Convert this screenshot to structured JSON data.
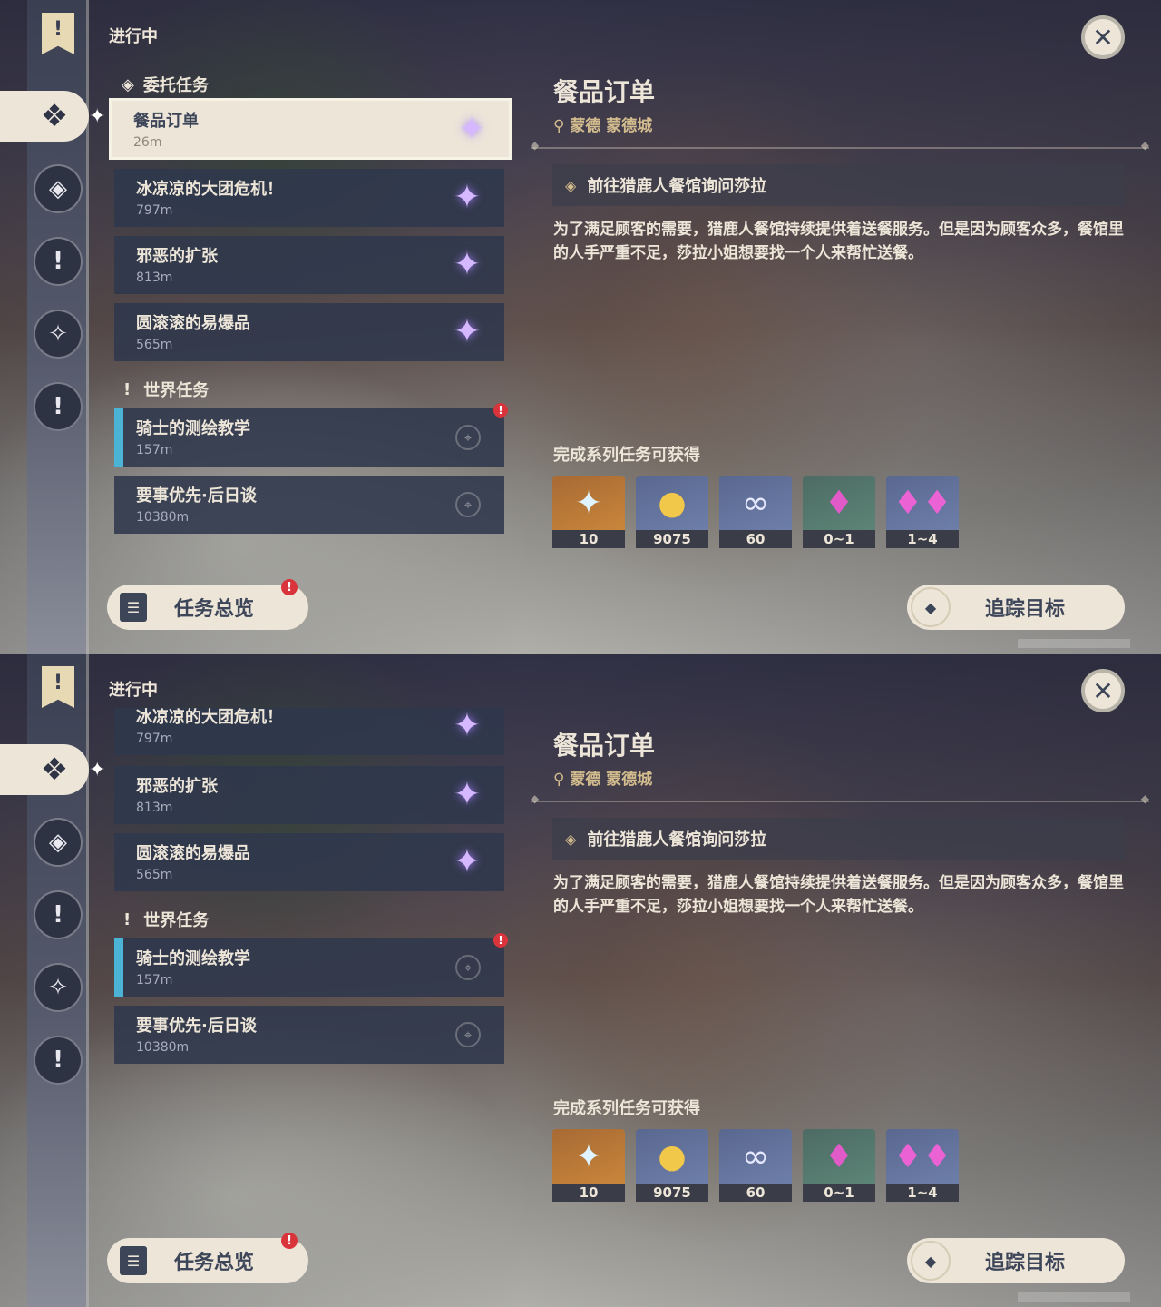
{
  "header": {
    "in_progress": "进行中",
    "close_icon": "close-icon"
  },
  "sections": {
    "commission": "委托任务",
    "world": "世界任务"
  },
  "quests": [
    {
      "name": "餐品订单",
      "dist": "26m"
    },
    {
      "name": "冰凉凉的大团危机！",
      "dist": "797m"
    },
    {
      "name": "邪恶的扩张",
      "dist": "813m"
    },
    {
      "name": "圆滚滚的易爆品",
      "dist": "565m"
    }
  ],
  "world_quests": [
    {
      "name": "骑士的测绘教学",
      "dist": "157m"
    },
    {
      "name": "要事优先·后日谈",
      "dist": "10380m"
    }
  ],
  "detail": {
    "title": "餐品订单",
    "location": "蒙德 蒙德城",
    "objective": "前往猎鹿人餐馆询问莎拉",
    "description": "为了满足顾客的需要，猎鹿人餐馆持续提供着送餐服务。但是因为顾客众多，餐馆里的人手严重不足，莎拉小姐想要找一个人来帮忙送餐。",
    "rewards_title": "完成系列任务可获得",
    "rewards": [
      {
        "icon": "primogem-icon",
        "count": "10"
      },
      {
        "icon": "mora-icon",
        "count": "9075"
      },
      {
        "icon": "companionship-exp-icon",
        "count": "60"
      },
      {
        "icon": "crystal-chunk-icon",
        "count": "0~1"
      },
      {
        "icon": "crystal-ore-icon",
        "count": "1~4"
      }
    ]
  },
  "buttons": {
    "overview": "任务总览",
    "track": "追踪目标"
  },
  "colors": {
    "accent_gold": "#d3bc8e",
    "cream": "#ece5d8",
    "panel": "#2f384c",
    "alert_red": "#d9343b",
    "world_mark": "#4ab3d6"
  }
}
